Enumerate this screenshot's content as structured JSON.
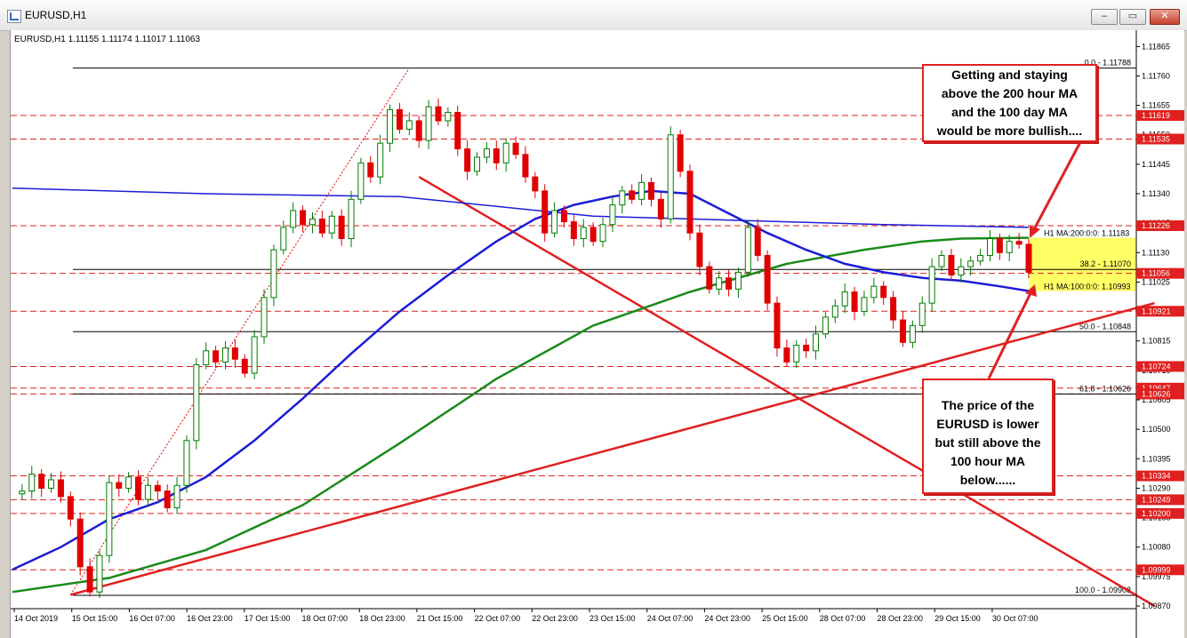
{
  "window": {
    "title": "EURUSD,H1",
    "buttons": [
      "minimize",
      "restore",
      "close"
    ]
  },
  "chart_header": "EURUSD,H1  1.11155 1.11174 1.11017 1.11063",
  "chart_data": {
    "type": "candlestick",
    "symbol": "EURUSD",
    "timeframe": "H1",
    "ohlc_header": {
      "open": 1.11155,
      "high": 1.11174,
      "low": 1.11017,
      "close": 1.11063
    },
    "ylim": [
      1.0987,
      1.11885
    ],
    "y_ticks": [
      1.11865,
      1.1176,
      1.11655,
      1.1155,
      1.11445,
      1.1134,
      1.11235,
      1.1113,
      1.11025,
      1.1092,
      1.10815,
      1.1071,
      1.10605,
      1.105,
      1.10395,
      1.1029,
      1.10185,
      1.1008,
      1.09975,
      1.0987
    ],
    "x_tick_labels": [
      "14 Oct 2019",
      "15 Oct 15:00",
      "16 Oct 07:00",
      "16 Oct 23:00",
      "17 Oct 15:00",
      "18 Oct 07:00",
      "18 Oct 23:00",
      "21 Oct 15:00",
      "22 Oct 07:00",
      "22 Oct 23:00",
      "23 Oct 15:00",
      "24 Oct 07:00",
      "24 Oct 23:00",
      "25 Oct 15:00",
      "28 Oct 07:00",
      "28 Oct 23:00",
      "29 Oct 15:00",
      "30 Oct 07:00"
    ],
    "price_levels": [
      1.11619,
      1.11535,
      1.11226,
      1.11056,
      1.10921,
      1.10724,
      1.10647,
      1.10626,
      1.10334,
      1.10249,
      1.102,
      1.09999
    ],
    "fibonacci": [
      {
        "label": "0.0 - 1.11788",
        "value": 1.11788
      },
      {
        "label": "38.2 - 1.11070",
        "value": 1.1107
      },
      {
        "label": "50.0 - 1.10848",
        "value": 1.10848
      },
      {
        "label": "61.8 - 1.10626",
        "value": 1.10626
      },
      {
        "label": "100.0 - 1.09908",
        "value": 1.09908
      }
    ],
    "indicator_labels": {
      "ma200": "H1 MA:200:0:0: 1.11183",
      "ma100": "H1 MA:100:0:0: 1.10993"
    },
    "price_path": [
      [
        0,
        1.1027
      ],
      [
        1,
        1.1028
      ],
      [
        2,
        1.1034
      ],
      [
        3,
        1.1029
      ],
      [
        4,
        1.1032
      ],
      [
        5,
        1.1026
      ],
      [
        6,
        1.1018
      ],
      [
        7,
        1.1001
      ],
      [
        8,
        1.0992
      ],
      [
        9,
        1.1005
      ],
      [
        10,
        1.1031
      ],
      [
        11,
        1.1029
      ],
      [
        12,
        1.1033
      ],
      [
        13,
        1.1025
      ],
      [
        14,
        1.103
      ],
      [
        15,
        1.1028
      ],
      [
        16,
        1.1022
      ],
      [
        17,
        1.103
      ],
      [
        18,
        1.1046
      ],
      [
        19,
        1.1073
      ],
      [
        20,
        1.1078
      ],
      [
        21,
        1.1074
      ],
      [
        22,
        1.1079
      ],
      [
        23,
        1.1075
      ],
      [
        24,
        1.107
      ],
      [
        25,
        1.1083
      ],
      [
        26,
        1.1097
      ],
      [
        27,
        1.1114
      ],
      [
        28,
        1.1122
      ],
      [
        29,
        1.1128
      ],
      [
        30,
        1.1123
      ],
      [
        31,
        1.1125
      ],
      [
        32,
        1.112
      ],
      [
        33,
        1.1126
      ],
      [
        34,
        1.1118
      ],
      [
        35,
        1.1132
      ],
      [
        36,
        1.1145
      ],
      [
        37,
        1.114
      ],
      [
        38,
        1.1152
      ],
      [
        39,
        1.1164
      ],
      [
        40,
        1.1157
      ],
      [
        41,
        1.116
      ],
      [
        42,
        1.1153
      ],
      [
        43,
        1.1165
      ],
      [
        44,
        1.116
      ],
      [
        45,
        1.1163
      ],
      [
        46,
        1.115
      ],
      [
        47,
        1.1142
      ],
      [
        48,
        1.1147
      ],
      [
        49,
        1.115
      ],
      [
        50,
        1.1145
      ],
      [
        51,
        1.1152
      ],
      [
        52,
        1.1148
      ],
      [
        53,
        1.114
      ],
      [
        54,
        1.1135
      ],
      [
        55,
        1.112
      ],
      [
        56,
        1.1128
      ],
      [
        57,
        1.1124
      ],
      [
        58,
        1.1118
      ],
      [
        59,
        1.1122
      ],
      [
        60,
        1.1117
      ],
      [
        61,
        1.1123
      ],
      [
        62,
        1.113
      ],
      [
        63,
        1.1135
      ],
      [
        64,
        1.1132
      ],
      [
        65,
        1.1138
      ],
      [
        66,
        1.1132
      ],
      [
        67,
        1.1125
      ],
      [
        68,
        1.1155
      ],
      [
        69,
        1.1142
      ],
      [
        70,
        1.112
      ],
      [
        71,
        1.1108
      ],
      [
        72,
        1.11
      ],
      [
        73,
        1.1104
      ],
      [
        74,
        1.11
      ],
      [
        75,
        1.1106
      ],
      [
        76,
        1.1122
      ],
      [
        77,
        1.1112
      ],
      [
        78,
        1.1095
      ],
      [
        79,
        1.1079
      ],
      [
        80,
        1.1074
      ],
      [
        81,
        1.108
      ],
      [
        82,
        1.1078
      ],
      [
        83,
        1.1084
      ],
      [
        84,
        1.109
      ],
      [
        85,
        1.1094
      ],
      [
        86,
        1.1099
      ],
      [
        87,
        1.1092
      ],
      [
        88,
        1.1097
      ],
      [
        89,
        1.1101
      ],
      [
        90,
        1.1097
      ],
      [
        91,
        1.1089
      ],
      [
        92,
        1.1081
      ],
      [
        93,
        1.1087
      ],
      [
        94,
        1.1095
      ],
      [
        95,
        1.1108
      ],
      [
        96,
        1.1112
      ],
      [
        97,
        1.1105
      ],
      [
        98,
        1.1108
      ],
      [
        99,
        1.111
      ],
      [
        100,
        1.1112
      ],
      [
        101,
        1.1118
      ],
      [
        102,
        1.1113
      ],
      [
        103,
        1.1117
      ],
      [
        104,
        1.1116
      ],
      [
        105,
        1.1106
      ]
    ],
    "ma100_path": [
      [
        0,
        1.1
      ],
      [
        5,
        1.1008
      ],
      [
        10,
        1.1018
      ],
      [
        15,
        1.1024
      ],
      [
        20,
        1.1033
      ],
      [
        25,
        1.1046
      ],
      [
        30,
        1.1061
      ],
      [
        35,
        1.1077
      ],
      [
        40,
        1.1092
      ],
      [
        45,
        1.1105
      ],
      [
        50,
        1.1117
      ],
      [
        54,
        1.1125
      ],
      [
        58,
        1.113
      ],
      [
        62,
        1.1133
      ],
      [
        66,
        1.1135
      ],
      [
        70,
        1.1134
      ],
      [
        74,
        1.1127
      ],
      [
        78,
        1.112
      ],
      [
        82,
        1.1114
      ],
      [
        86,
        1.1109
      ],
      [
        90,
        1.1106
      ],
      [
        94,
        1.1104
      ],
      [
        98,
        1.1103
      ],
      [
        102,
        1.1101
      ],
      [
        105,
        1.10993
      ]
    ],
    "ma200_path": [
      [
        0,
        1.0992
      ],
      [
        10,
        1.0997
      ],
      [
        20,
        1.1007
      ],
      [
        30,
        1.1023
      ],
      [
        40,
        1.1045
      ],
      [
        50,
        1.1068
      ],
      [
        60,
        1.1087
      ],
      [
        70,
        1.1099
      ],
      [
        80,
        1.1109
      ],
      [
        88,
        1.1114
      ],
      [
        94,
        1.1117
      ],
      [
        98,
        1.1118
      ],
      [
        105,
        1.11183
      ]
    ],
    "daily_ma_path": [
      [
        0,
        1.1136
      ],
      [
        20,
        1.1134
      ],
      [
        40,
        1.1133
      ],
      [
        60,
        1.1126
      ],
      [
        70,
        1.1125
      ],
      [
        80,
        1.1124
      ],
      [
        90,
        1.1123
      ],
      [
        105,
        1.1122
      ]
    ],
    "trendlines": [
      {
        "name": "rising-trendline",
        "from": [
          6,
          1.0991
        ],
        "to": [
          118,
          1.1095
        ]
      },
      {
        "name": "falling-trendline",
        "from": [
          42,
          1.114
        ],
        "to": [
          118,
          1.0987
        ]
      }
    ],
    "highlight_zone": {
      "from": 1.11183,
      "to": 1.10993
    }
  },
  "annotations": {
    "top": "Getting and staying\nabove the 200 hour MA\nand the 100 day MA\nwould be more bullish....",
    "bottom": "The price of the\nEURUSD is lower\nbut still above the\n100 hour MA\nbelow......"
  },
  "colors": {
    "background": "#ffffff",
    "bull": "#007b00",
    "bear": "#e00000",
    "ma100": "#1c1cd8",
    "ma200": "#1a8a1a",
    "trend": "#e02020",
    "level": "#e02020",
    "zone": "#ffff66"
  }
}
